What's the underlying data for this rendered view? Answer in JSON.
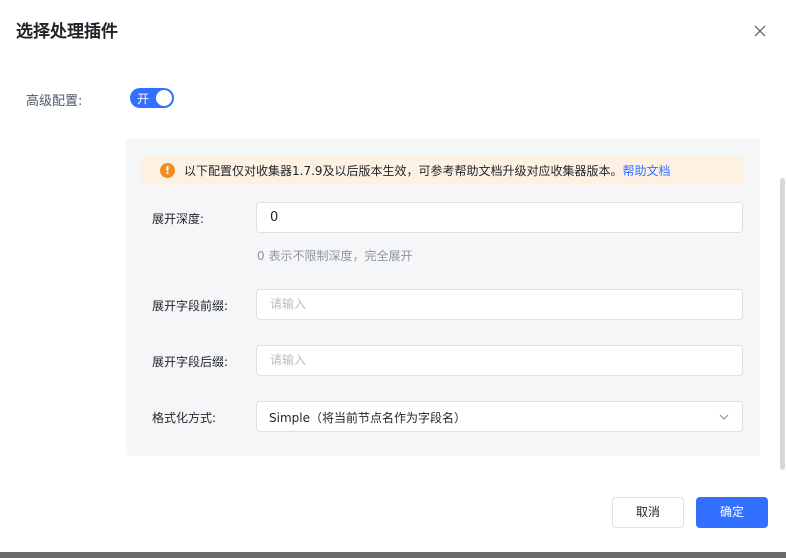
{
  "dialog": {
    "title": "选择处理插件"
  },
  "advanced": {
    "label": "高级配置:",
    "switch_text": "开",
    "enabled": true
  },
  "alert": {
    "text": "以下配置仅对收集器1.7.9及以后版本生效，可参考帮助文档升级对应收集器版本。",
    "link": "帮助文档"
  },
  "fields": {
    "depth": {
      "label": "展开深度:",
      "value": "0",
      "hint": "0 表示不限制深度，完全展开"
    },
    "prefix": {
      "label": "展开字段前缀:",
      "value": "",
      "placeholder": "请输入"
    },
    "suffix": {
      "label": "展开字段后缀:",
      "value": "",
      "placeholder": "请输入"
    },
    "format": {
      "label": "格式化方式:",
      "selected": "Simple（将当前节点名作为字段名）"
    }
  },
  "footer": {
    "cancel_label": "取消",
    "ok_label": "确定"
  },
  "colors": {
    "primary": "#3370ff",
    "warning": "#f08c22",
    "alert_bg": "#fdf1e3",
    "panel_bg": "#f5f6f7"
  },
  "icons": {
    "close": "close-icon",
    "warning": "warning-icon",
    "dropdown": "chevron-down-icon"
  }
}
